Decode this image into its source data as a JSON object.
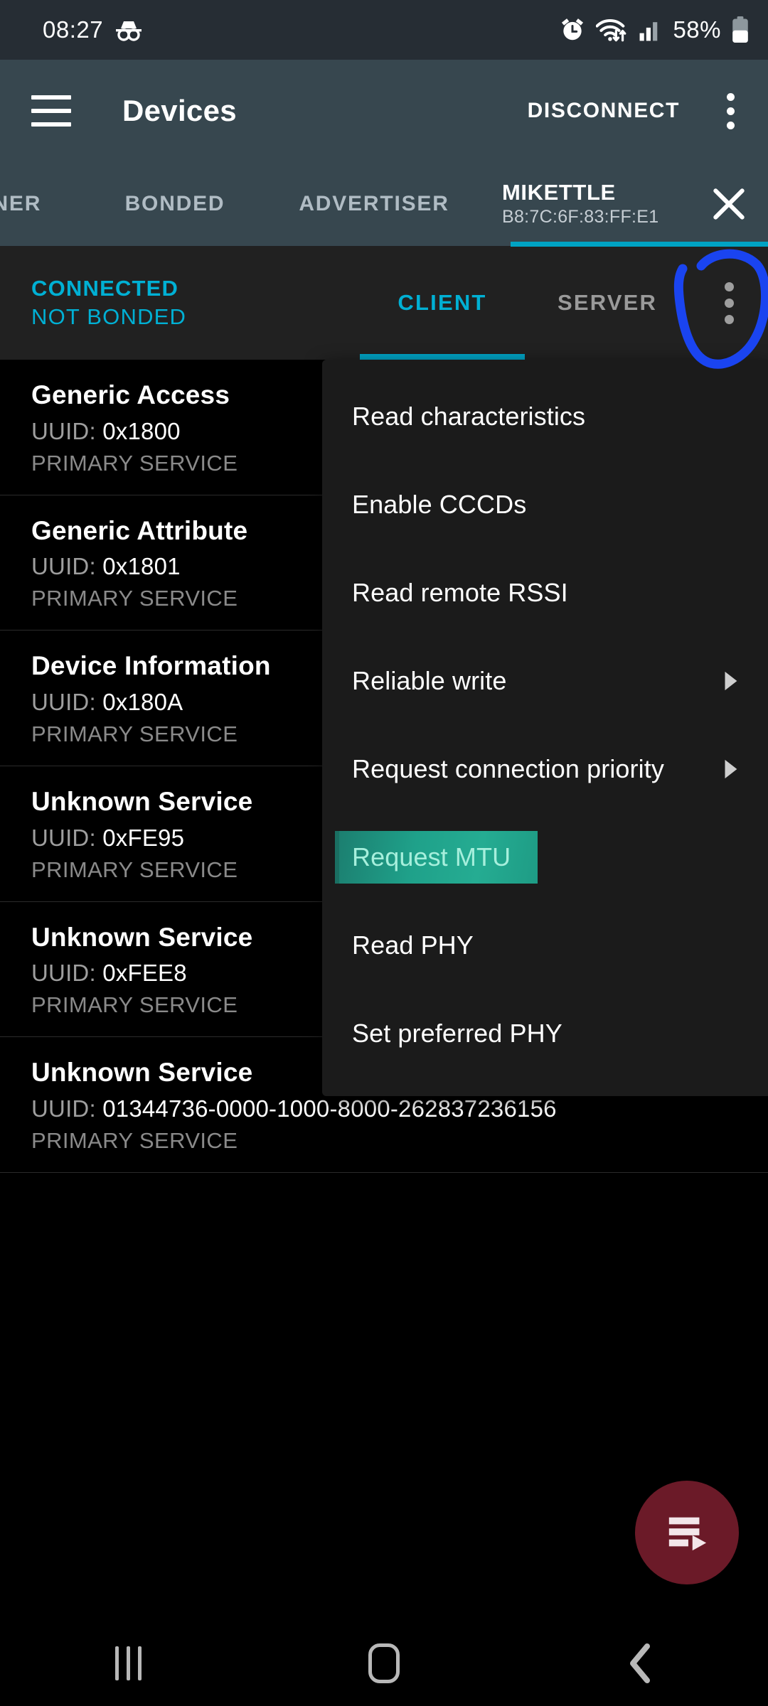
{
  "status_bar": {
    "time": "08:27",
    "incognito_icon": "incognito-icon",
    "alarm_icon": "alarm-clock-icon",
    "wifi_icon": "wifi-transfer-icon",
    "signal_icon": "cellular-signal-icon",
    "battery_percent": "58%",
    "battery_icon": "battery-icon"
  },
  "app_bar": {
    "menu_icon": "hamburger-menu-icon",
    "title": "Devices",
    "disconnect_label": "DISCONNECT",
    "overflow_icon": "overflow-menu-icon"
  },
  "tabs": [
    {
      "label": "NNER",
      "active": false
    },
    {
      "label": "BONDED",
      "active": false
    },
    {
      "label": "ADVERTISER",
      "active": false
    }
  ],
  "device_tab": {
    "name": "MIKETTLE",
    "mac": "B8:7C:6F:83:FF:E1",
    "close_icon": "close-icon",
    "active": true
  },
  "connection": {
    "state": "CONNECTED",
    "bond_state": "NOT BONDED",
    "sub_tabs": [
      {
        "label": "CLIENT",
        "active": true
      },
      {
        "label": "SERVER",
        "active": false
      }
    ],
    "overflow_icon": "overflow-menu-icon"
  },
  "annotation": {
    "shape": "hand-drawn-circle",
    "color": "#1a44f0",
    "target": "client-server-overflow-menu"
  },
  "services": [
    {
      "name": "Generic Access",
      "uuid_label": "UUID:",
      "uuid": "0x1800",
      "type": "PRIMARY SERVICE"
    },
    {
      "name": "Generic Attribute",
      "uuid_label": "UUID:",
      "uuid": "0x1801",
      "type": "PRIMARY SERVICE"
    },
    {
      "name": "Device Information",
      "uuid_label": "UUID:",
      "uuid": "0x180A",
      "type": "PRIMARY SERVICE"
    },
    {
      "name": "Unknown Service",
      "uuid_label": "UUID:",
      "uuid": "0xFE95",
      "type": "PRIMARY SERVICE"
    },
    {
      "name": "Unknown Service",
      "uuid_label": "UUID:",
      "uuid": "0xFEE8",
      "type": "PRIMARY SERVICE"
    },
    {
      "name": "Unknown Service",
      "uuid_label": "UUID:",
      "uuid": "01344736-0000-1000-8000-262837236156",
      "type": "PRIMARY SERVICE"
    }
  ],
  "popup_menu": {
    "items": [
      {
        "label": "Read characteristics",
        "submenu": false,
        "highlighted": false
      },
      {
        "label": "Enable CCCDs",
        "submenu": false,
        "highlighted": false
      },
      {
        "label": "Read remote RSSI",
        "submenu": false,
        "highlighted": false
      },
      {
        "label": "Reliable write",
        "submenu": true,
        "highlighted": false
      },
      {
        "label": "Request connection priority",
        "submenu": true,
        "highlighted": false
      },
      {
        "label": "Request MTU",
        "submenu": false,
        "highlighted": true
      },
      {
        "label": "Read PHY",
        "submenu": false,
        "highlighted": false
      },
      {
        "label": "Set preferred PHY",
        "submenu": false,
        "highlighted": false
      }
    ]
  },
  "fab": {
    "icon": "log-play-icon",
    "color": "#6b1a28"
  },
  "nav_bar": {
    "recents_icon": "recents-icon",
    "home_icon": "home-icon",
    "back_icon": "back-icon"
  },
  "theme": {
    "accent_cyan": "#00b0d4",
    "appbar_bg": "#37474f",
    "statusbar_bg": "#262d34",
    "page_bg": "#000000",
    "menu_bg": "#1b1b1b",
    "highlight_teal": "#1fa18a"
  }
}
